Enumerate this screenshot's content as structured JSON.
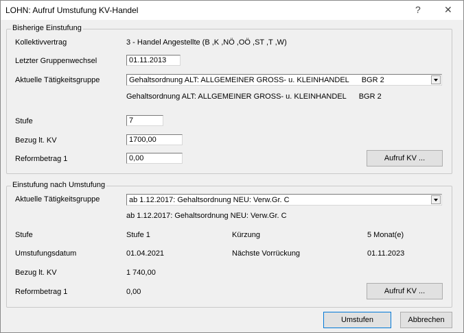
{
  "window": {
    "title": "LOHN: Aufruf Umstufung KV-Handel",
    "help_label": "?",
    "close_label": "✕"
  },
  "bisherige": {
    "legend": "Bisherige Einstufung",
    "kollektivvertrag_label": "Kollektivvertrag",
    "kollektivvertrag_value": "3 - Handel Angestellte (B ,K ,NÖ ,OÖ ,ST ,T ,W)",
    "letzter_label": "Letzter Gruppenwechsel",
    "letzter_value": "01.11.2013",
    "taetigkeit_label": "Aktuelle Tätigkeitsgruppe",
    "taetigkeit_value": "Gehaltsordnung ALT: ALLGEMEINER GROSS- u. KLEINHANDEL      BGR 2",
    "taetigkeit_desc": "Gehaltsordnung ALT: ALLGEMEINER GROSS- u. KLEINHANDEL      BGR 2",
    "stufe_label": "Stufe",
    "stufe_value": "7",
    "bezug_label": "Bezug lt. KV",
    "bezug_value": "1700,00",
    "reform_label": "Reformbetrag 1",
    "reform_value": "0,00",
    "aufruf_label": "Aufruf KV ..."
  },
  "nach": {
    "legend": "Einstufung nach Umstufung",
    "taetigkeit_label": "Aktuelle Tätigkeitsgruppe",
    "taetigkeit_value": "ab 1.12.2017: Gehaltsordnung NEU: Verw.Gr. C",
    "taetigkeit_desc": "ab 1.12.2017: Gehaltsordnung NEU: Verw.Gr. C",
    "stufe_label": "Stufe",
    "stufe_value": "Stufe 1",
    "kuerzung_label": "Kürzung",
    "kuerzung_value": "5 Monat(e)",
    "umstufungsdatum_label": "Umstufungsdatum",
    "umstufungsdatum_value": "01.04.2021",
    "naechste_label": "Nächste Vorrückung",
    "naechste_value": "01.11.2023",
    "bezug_label": "Bezug lt. KV",
    "bezug_value": "1 740,00",
    "reform_label": "Reformbetrag 1",
    "reform_value": "0,00",
    "aufruf_label": "Aufruf KV ..."
  },
  "footer": {
    "umstufen_label": "Umstufen",
    "abbrechen_label": "Abbrechen"
  }
}
